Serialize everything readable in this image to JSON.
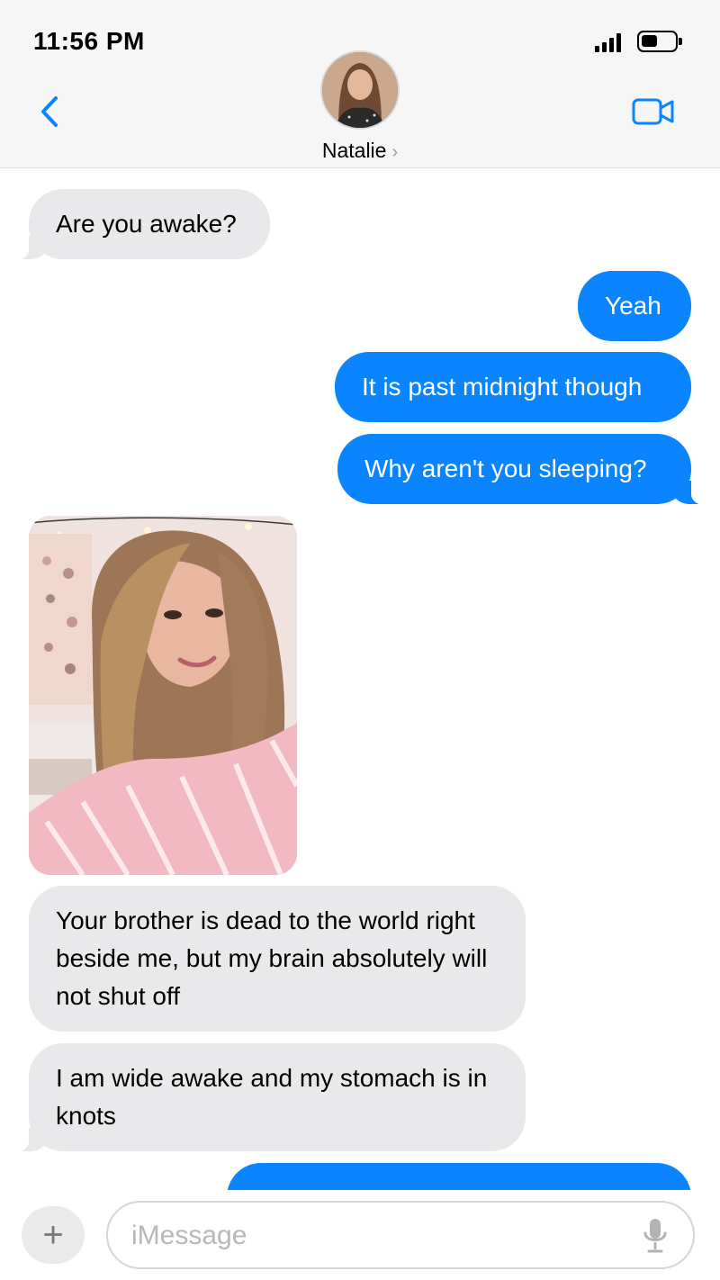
{
  "status_bar": {
    "time": "11:56 PM",
    "battery_icon": "battery-icon",
    "signal_icon": "signal-bars-icon"
  },
  "header": {
    "back_icon": "chevron-left-icon",
    "contact_name": "Natalie",
    "contact_chevron": "›",
    "video_icon": "video-camera-icon",
    "accent_color": "#0b84ff"
  },
  "messages": [
    {
      "direction": "incoming",
      "text": "Are you awake?"
    },
    {
      "direction": "outgoing",
      "text": "Yeah"
    },
    {
      "direction": "outgoing",
      "text": "It is past midnight though"
    },
    {
      "direction": "outgoing",
      "text": "Why aren't you sleeping?"
    },
    {
      "direction": "incoming",
      "type": "photo"
    },
    {
      "direction": "incoming",
      "text": "Your brother is dead to the world right beside me, but my brain absolutely will not shut off"
    },
    {
      "direction": "incoming",
      "text": "I am wide awake and my stomach is in knots"
    }
  ],
  "composer": {
    "plus_label": "+",
    "placeholder": "iMessage",
    "mic_icon": "microphone-icon"
  }
}
